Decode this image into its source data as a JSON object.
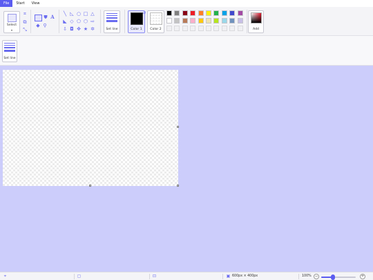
{
  "menu": [
    {
      "label": "File",
      "active": true
    },
    {
      "label": "Start",
      "active": false
    },
    {
      "label": "View",
      "active": false
    }
  ],
  "ribbon": {
    "select_label": "Select",
    "set_line_label": "Set line",
    "color1_label": "Color 1",
    "color2_label": "Color 2",
    "add_label": "Add",
    "color1": "#000000",
    "palette": [
      [
        "#000000",
        "#7f7f7f",
        "#880015",
        "#ed1c24",
        "#ff7f27",
        "#fff200",
        "#22b14c",
        "#00a2e8",
        "#3f48cc",
        "#a349a4"
      ],
      [
        "#ffffff",
        "#c3c3c3",
        "#b97a57",
        "#ffaec9",
        "#ffc90e",
        "#efe4b0",
        "#b5e61d",
        "#99d9ea",
        "#7092be",
        "#c8bfe7"
      ],
      [
        "empty",
        "empty",
        "empty",
        "empty",
        "empty",
        "empty",
        "empty",
        "empty",
        "empty",
        "empty"
      ]
    ]
  },
  "toolbar2": {
    "set_line_label": "Set line"
  },
  "status": {
    "size_text": "600px × 400px",
    "zoom_text": "100%",
    "zoom_minus": "−",
    "zoom_plus": "+",
    "zoom_level": 0.33
  },
  "accent": "#5b5cf0",
  "workspace_color": "#cccdfb"
}
